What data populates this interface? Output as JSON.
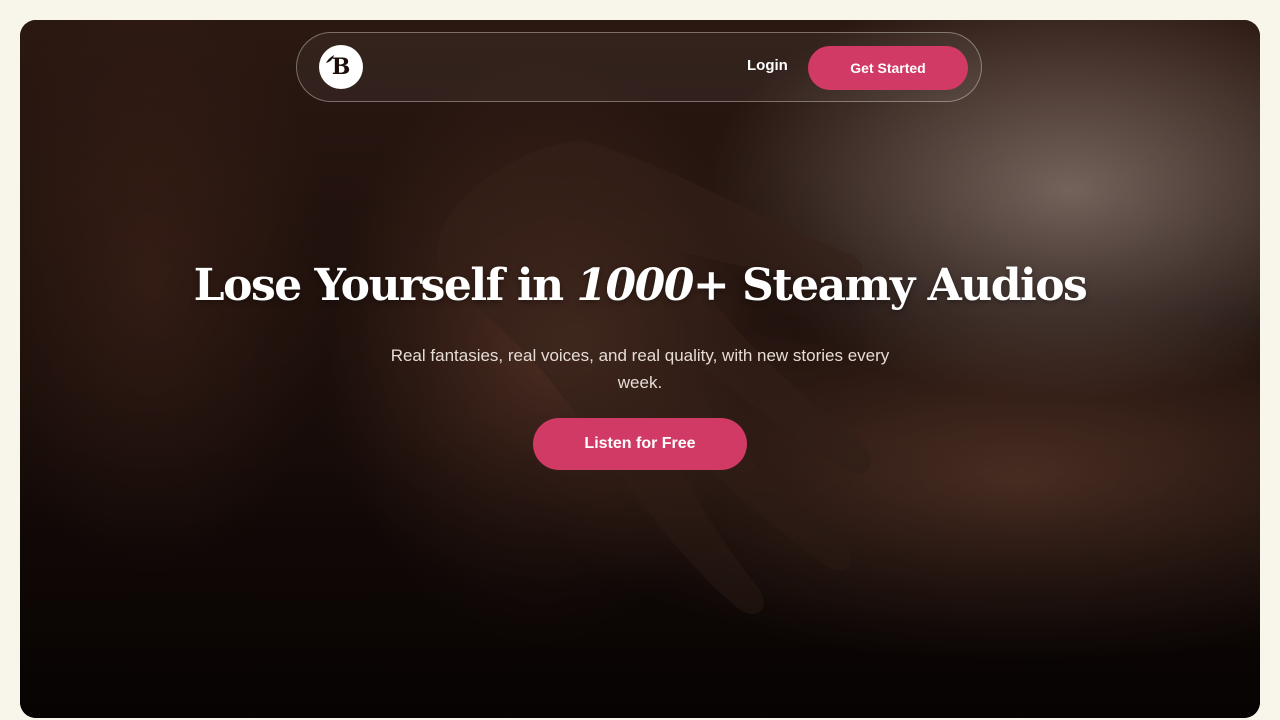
{
  "nav": {
    "logo_letter": "B",
    "login_label": "Login",
    "cta_label": "Get Started"
  },
  "hero": {
    "headline_pre": "Lose Yourself in ",
    "headline_emphasis": "1000",
    "headline_post": "+ Steamy Audios",
    "subtitle": "Real fantasies, real voices, and real quality, with new stories every week.",
    "cta_label": "Listen for Free"
  },
  "colors": {
    "page_background": "#f8f5ea",
    "accent": "#d03a64",
    "hero_dark": "#1a0c09"
  },
  "icons": {
    "logo": "leaf-b-logo-icon"
  }
}
